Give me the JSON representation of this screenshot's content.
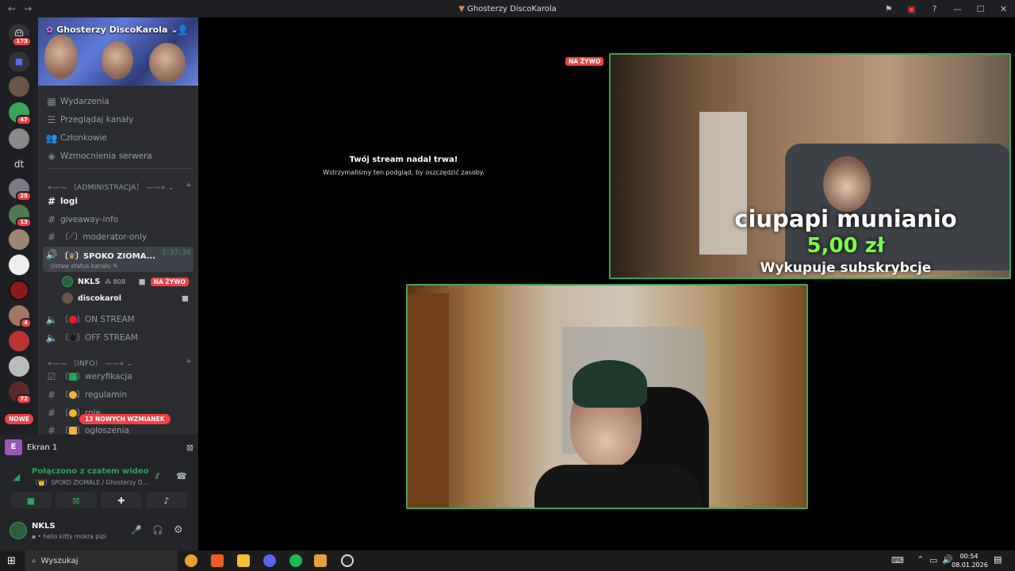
{
  "window": {
    "title": "Ghosterzy DiscoKarola"
  },
  "guilds": [
    {
      "badge": "173"
    },
    {
      "badge": ""
    },
    {
      "badge": ""
    },
    {
      "badge": "47"
    },
    {
      "badge": ""
    },
    {
      "label": "dt"
    },
    {
      "badge": "25"
    },
    {
      "badge": "13"
    },
    {
      "badge": ""
    },
    {
      "badge": ""
    },
    {
      "badge": ""
    },
    {
      "badge": "4"
    },
    {
      "badge": ""
    },
    {
      "badge": ""
    },
    {
      "badge": "72"
    }
  ],
  "server": {
    "name": "Ghosterzy DiscoKarola"
  },
  "menu": [
    "Wydarzenia",
    "Przeglądaj kanały",
    "Członkowie",
    "Wzmocnienia serwera"
  ],
  "categories": {
    "admin": "〔ADMINISTRACJA〕",
    "info": "〔INFO〕"
  },
  "channels": {
    "logi": "logi",
    "giveaway": "giveaway-info",
    "moderator": "moderator-only",
    "voice_active": "SPOKO ZIOMA...",
    "voice_time": "1:37:34",
    "voice_status": "Ustaw status kanału",
    "on_stream": "ON STREAM",
    "off_stream": "OFF STREAM",
    "weryfikacja": "weryfikacja",
    "regulamin": "regulamin",
    "role": "role",
    "ogloszenia": "ogłoszenia"
  },
  "voice_users": [
    {
      "name": "NKLS",
      "extra": "808",
      "live": "NA ŻYWO"
    },
    {
      "name": "discokarol"
    }
  ],
  "badges": {
    "nowe": "NOWE",
    "mentions": "13 NOWYCH WZMIANEK"
  },
  "screen": {
    "label": "Ekran 1",
    "initial": "E"
  },
  "connection": {
    "status": "Połączono z czatem wideo",
    "channel": "〔👑〕SPOKO ZIOMALE / Ghosterzy D..."
  },
  "user": {
    "name": "NKLS",
    "status": "hello kitty mokra pipi"
  },
  "stage": {
    "notice_title": "Twój stream nadal trwa!",
    "notice_sub": "Wstrzymaliśmy ten podgląd, by oszczędzić zasoby.",
    "live": "NA ŻYWO",
    "alert_name": "ciupapi munianio",
    "alert_amount": "5,00 zł",
    "alert_text": "Wykupuje subskrybcje"
  },
  "taskbar": {
    "search": "Wyszukaj",
    "time": "00:54",
    "date": "08.01.2026"
  }
}
